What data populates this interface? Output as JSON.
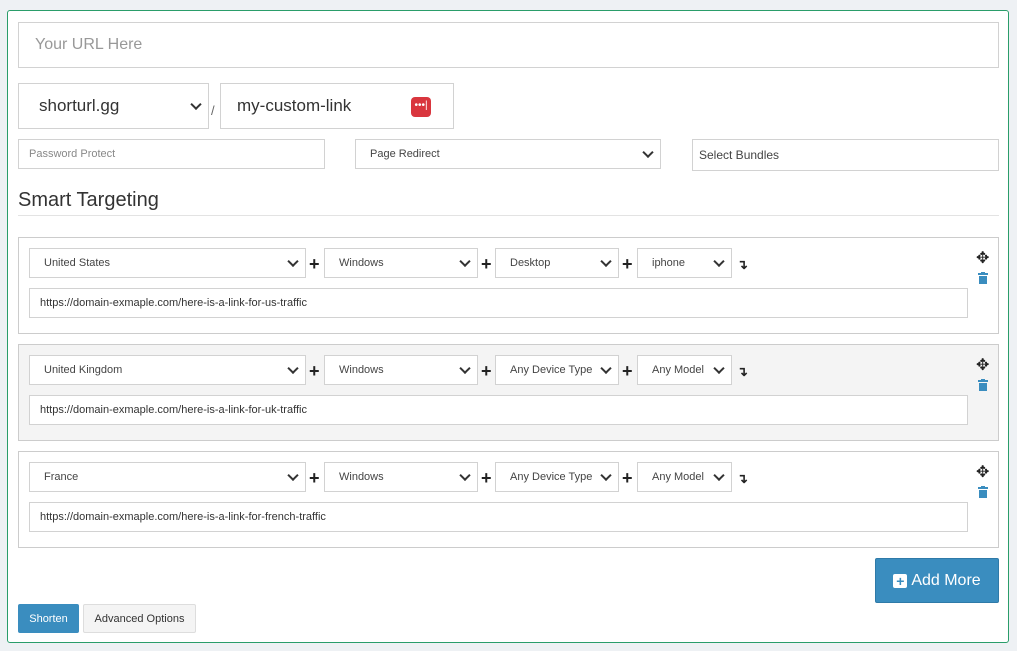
{
  "url_input": {
    "placeholder": "Your URL Here"
  },
  "domain_select": {
    "value": "shorturl.gg"
  },
  "separator": "/",
  "custom_alias": {
    "value": "my-custom-link"
  },
  "password": {
    "placeholder": "Password Protect"
  },
  "redirect_select": {
    "value": "Page Redirect"
  },
  "bundles": {
    "placeholder": "Select Bundles"
  },
  "section_title": "Smart Targeting",
  "plus": "+",
  "rules": [
    {
      "country": "United States",
      "os": "Windows",
      "device": "Desktop",
      "model": "iphone",
      "url": "https://domain-exmaple.com/here-is-a-link-for-us-traffic"
    },
    {
      "country": "United Kingdom",
      "os": "Windows",
      "device": "Any Device Type",
      "model": "Any Model",
      "url": "https://domain-exmaple.com/here-is-a-link-for-uk-traffic"
    },
    {
      "country": "France",
      "os": "Windows",
      "device": "Any Device Type",
      "model": "Any Model",
      "url": "https://domain-exmaple.com/here-is-a-link-for-french-traffic"
    }
  ],
  "add_more": "Add More",
  "shorten": "Shorten",
  "advanced": "Advanced Options",
  "colors": {
    "primary": "#3a8dbf",
    "border_accent": "#2a9d6a",
    "password_manager_icon": "#d9363e"
  }
}
